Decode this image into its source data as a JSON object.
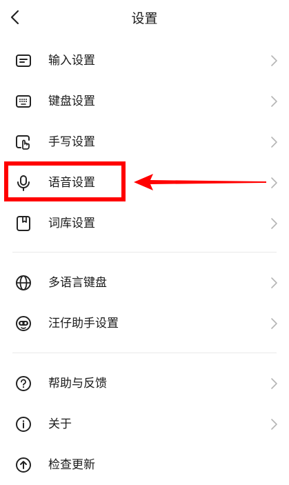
{
  "header": {
    "title": "设置"
  },
  "group1": {
    "items": [
      {
        "label": "输入设置",
        "icon": "input-settings-icon"
      },
      {
        "label": "键盘设置",
        "icon": "keyboard-icon"
      },
      {
        "label": "手写设置",
        "icon": "handwriting-icon"
      },
      {
        "label": "语音设置",
        "icon": "microphone-icon"
      },
      {
        "label": "词库设置",
        "icon": "dictionary-icon"
      }
    ]
  },
  "group2": {
    "items": [
      {
        "label": "多语言键盘",
        "icon": "globe-icon"
      },
      {
        "label": "汪仔助手设置",
        "icon": "assistant-icon"
      }
    ]
  },
  "group3": {
    "items": [
      {
        "label": "帮助与反馈",
        "icon": "help-icon"
      },
      {
        "label": "关于",
        "icon": "info-icon"
      },
      {
        "label": "检查更新",
        "icon": "update-icon"
      }
    ]
  },
  "colors": {
    "annotation": "#ff0000",
    "chevron": "#b5b5b5",
    "icon": "#222222"
  }
}
